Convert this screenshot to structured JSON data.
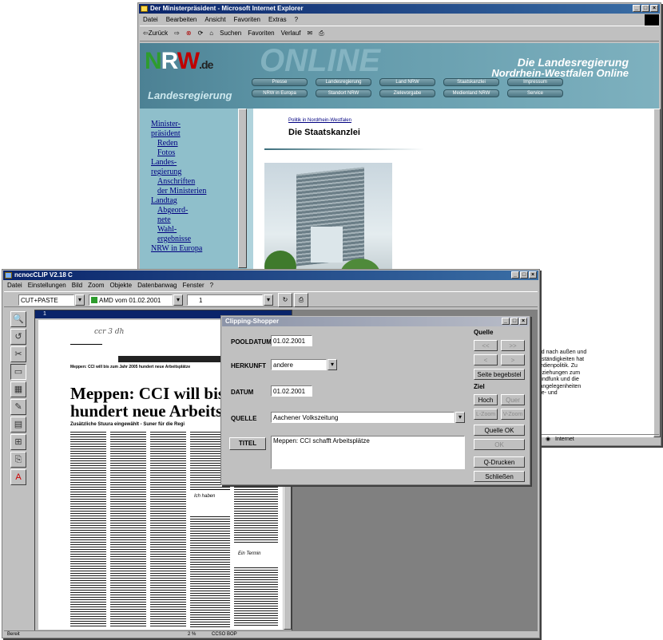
{
  "ie": {
    "title": "Der Ministerpräsident - Microsoft Internet Explorer",
    "menu": [
      "Datei",
      "Bearbeiten",
      "Ansicht",
      "Favoriten",
      "Extras",
      "?"
    ],
    "toolbar": {
      "back": "⇦Zurück",
      "fwd": "⇨",
      "search": "Suchen",
      "favorites": "Favoriten",
      "history": "Verlauf"
    },
    "site": {
      "logo": "NRW.de",
      "online": "ONLINE",
      "section": "Landesregierung",
      "headline1": "Die Landesregierung",
      "headline2": "Nordrhein-Westfalen Online",
      "nav_row1": [
        "Presse",
        "Landesregierung",
        "Land NRW",
        "Staatskanzlei",
        "Impressum"
      ],
      "nav_row2": [
        "NRW in Europa",
        "Standort NRW",
        "Zielevorgabe",
        "Medienland NRW",
        "Service"
      ],
      "breadcrumb": "Politik in Nordrhein-Westfalen",
      "page_title": "Die Staatskanzlei",
      "sidebar": [
        {
          "text": "Minister-",
          "lvl": 0
        },
        {
          "text": "präsident",
          "lvl": 0
        },
        {
          "text": "Reden",
          "lvl": 1
        },
        {
          "text": "Fotos",
          "lvl": 1
        },
        {
          "text": "Landes-",
          "lvl": 0
        },
        {
          "text": "regierung",
          "lvl": 0
        },
        {
          "text": "Anschriften",
          "lvl": 1
        },
        {
          "text": "der Ministerien",
          "lvl": 1
        },
        {
          "text": "Landtag",
          "lvl": 0
        },
        {
          "text": "Abgeord-",
          "lvl": 1
        },
        {
          "text": "nete",
          "lvl": 1
        },
        {
          "text": "Wahl-",
          "lvl": 1
        },
        {
          "text": "ergebnisse",
          "lvl": 1
        },
        {
          "text": "NRW in Europa",
          "lvl": 0
        }
      ],
      "body_lines": [
        "and nach außen und",
        "Zuständigkeiten hat",
        "Medienpolitik. Zu",
        "Beziehungen zum",
        "Rundfunk und die",
        "stangelegenheiten",
        "ebe- und"
      ]
    },
    "status": "Internet"
  },
  "app": {
    "title": "ncnocCLIP V2.18 C",
    "menu": [
      "Datei",
      "Einstellungen",
      "Bild",
      "Zoom",
      "Objekte",
      "Datenbanwag",
      "Fenster",
      "?"
    ],
    "combo_mode": "CUT+PASTE",
    "combo_issue": "AMD vom 01.02.2001",
    "combo_page": "1",
    "doc_title": "1",
    "handwriting": "ccr 3 dh",
    "newspaper": {
      "kicker": "Meppen: CCI will bis zum Jahr 2005 hundert neue Arbeitsplätze",
      "headline1": "Meppen: CCI will bis zu",
      "headline2": "hundert neue Arbeitspl",
      "subline": "Zusätzliche Stuura eingewählt - Suner für die Regi",
      "quote1": "Ich haben",
      "quote2": "Ein Termin"
    },
    "status": [
      "Bereit",
      "2 %",
      "CCSO BOP"
    ]
  },
  "dialog": {
    "title": "Clipping-Shopper",
    "labels": {
      "pooldatum": "POOLDATUM",
      "herkunft": "HERKUNFT",
      "datum": "DATUM",
      "quelle": "QUELLE",
      "titel": "TITEL"
    },
    "values": {
      "pooldatum": "01.02.2001",
      "herkunft": "andere",
      "datum": "01.02.2001",
      "quelle": "Aachener Volkszeitung",
      "titel": "Meppen: CCI schafft Arbeitsplätze"
    },
    "quelle_group": "Quelle",
    "ziel_group": "Ziel",
    "buttons": {
      "nav1": "<<",
      "nav2": ">>",
      "nav3": "<",
      "nav4": ">",
      "seite": "Seite begebstel",
      "hoch": "Hoch",
      "quer": "Quer",
      "lzoom": "L-Zoom",
      "vzoom": "V-Zoom",
      "quelle_ok": "Quelle OK",
      "ok": "OK",
      "drucken": "Q-Drucken",
      "schliessen": "Schließen"
    }
  }
}
